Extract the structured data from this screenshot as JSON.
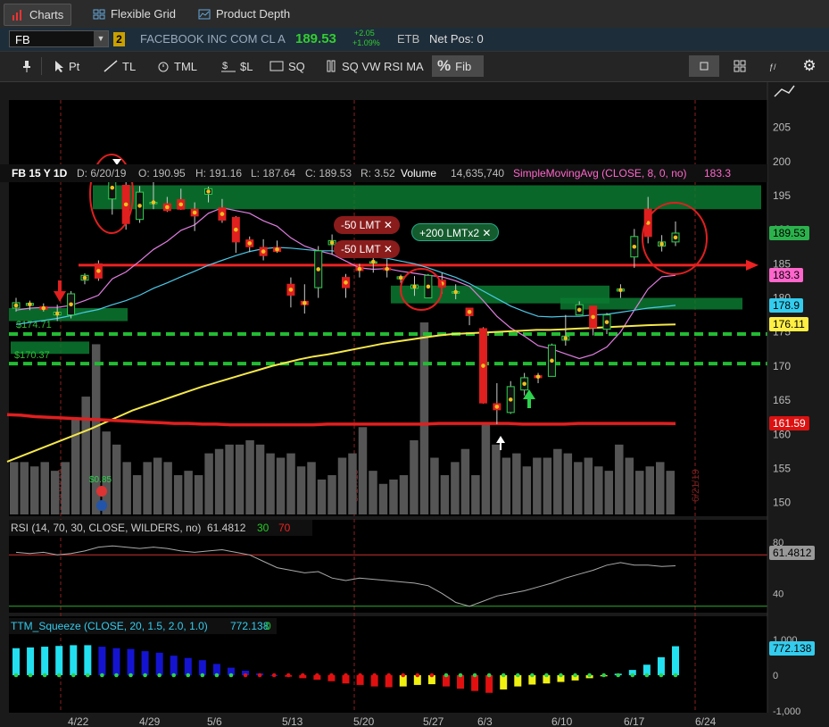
{
  "tabs": [
    {
      "label": "Charts",
      "icon": "bar-chart-icon"
    },
    {
      "label": "Flexible Grid",
      "icon": "grid-icon"
    },
    {
      "label": "Product Depth",
      "icon": "depth-icon"
    }
  ],
  "symbol": {
    "value": "FB",
    "link": "2",
    "name": "FACEBOOK INC COM CL A",
    "price": "189.53",
    "change": "+2.05",
    "change_pct": "+1.09%",
    "exchange": "ETB",
    "position": "Net Pos: 0"
  },
  "toolbar": {
    "items": [
      "Pt",
      "TL",
      "TML",
      "$L",
      "SQ",
      "SQ VW RSI MA",
      "Fib"
    ]
  },
  "info": {
    "title": "FB 15 Y 1D",
    "date": "D: 6/20/19",
    "open": "O: 190.95",
    "high": "H: 191.16",
    "low": "L: 187.64",
    "close": "C: 189.53",
    "range": "R: 3.52",
    "volume_label": "Volume",
    "volume": "14,635,740",
    "sma": "SimpleMovingAvg (CLOSE, 8, 0, no)",
    "sma_value": "183.3"
  },
  "price_axis": [
    "205",
    "200",
    "195",
    "190",
    "185",
    "180",
    "175",
    "170",
    "165",
    "160",
    "155",
    "150"
  ],
  "price_labels": [
    {
      "text": "189.53",
      "bg": "#2bb24c",
      "fg": "#000"
    },
    {
      "text": "183.3",
      "bg": "#ff66cc",
      "fg": "#000"
    },
    {
      "text": "178.9",
      "bg": "#33ccee",
      "fg": "#000"
    },
    {
      "text": "176.11",
      "bg": "#ffee44",
      "fg": "#000"
    },
    {
      "text": "161.59",
      "bg": "#dd1111",
      "fg": "#fff"
    }
  ],
  "zone_labels": [
    "$174.71",
    "$170.37"
  ],
  "orders": [
    "-50 LMT",
    "-50 LMT",
    "+200 LMTx2"
  ],
  "date_markers": [
    "4/19/19",
    "5/17/19",
    "6/21/19"
  ],
  "dividend": "$0.85",
  "rsi": {
    "title": "RSI (14, 70, 30, CLOSE, WILDERS, no)",
    "value": "61.4812",
    "ob": "30",
    "os": "70",
    "axis": [
      "80",
      "40"
    ],
    "label": "61.4812"
  },
  "ttm": {
    "title": "TTM_Squeeze (CLOSE, 20, 1.5, 2.0, 1.0)",
    "value": "772.138",
    "zero": "0",
    "axis": [
      "1,000",
      "0",
      "-1,000"
    ],
    "label": "772.138"
  },
  "x_axis": [
    "4/22",
    "4/29",
    "5/6",
    "5/13",
    "5/20",
    "5/27",
    "6/3",
    "6/10",
    "6/17",
    "6/24"
  ],
  "chart_data": {
    "type": "candlestick",
    "title": "FB 15 Y 1D",
    "ylim": [
      148,
      209
    ],
    "candles": [
      {
        "o": 178.5,
        "h": 180,
        "l": 178,
        "c": 179.3
      },
      {
        "o": 178.9,
        "h": 179.6,
        "l": 178.2,
        "c": 179.2
      },
      {
        "o": 178.7,
        "h": 179.2,
        "l": 178,
        "c": 178.3
      },
      {
        "o": 177.5,
        "h": 179,
        "l": 176.6,
        "c": 177.9
      },
      {
        "o": 177.5,
        "h": 181,
        "l": 177,
        "c": 180.6
      },
      {
        "o": 182.6,
        "h": 183.6,
        "l": 182,
        "c": 183.3
      },
      {
        "o": 185,
        "h": 185.5,
        "l": 182.5,
        "c": 182.9
      },
      {
        "o": 194.5,
        "h": 199.5,
        "l": 192.2,
        "c": 197.8
      },
      {
        "o": 196.5,
        "h": 197,
        "l": 190,
        "c": 190.9
      },
      {
        "o": 191.5,
        "h": 196.4,
        "l": 191,
        "c": 195.5
      },
      {
        "o": 194,
        "h": 197.8,
        "l": 193,
        "c": 194
      },
      {
        "o": 193.8,
        "h": 194.8,
        "l": 192.6,
        "c": 192.8
      },
      {
        "o": 194.4,
        "h": 196,
        "l": 192.9,
        "c": 193
      },
      {
        "o": 193,
        "h": 194,
        "l": 189.8,
        "c": 192
      },
      {
        "o": 195.2,
        "h": 196.3,
        "l": 194,
        "c": 196
      },
      {
        "o": 193.2,
        "h": 194.5,
        "l": 191,
        "c": 191.4
      },
      {
        "o": 191.8,
        "h": 192,
        "l": 186.6,
        "c": 188.2
      },
      {
        "o": 188.5,
        "h": 189,
        "l": 186.7,
        "c": 187.5
      },
      {
        "o": 187.4,
        "h": 188.6,
        "l": 185.5,
        "c": 186.2
      },
      {
        "o": 187.4,
        "h": 188.4,
        "l": 186.6,
        "c": 186.8
      },
      {
        "o": 182,
        "h": 183,
        "l": 178.6,
        "c": 180.4
      },
      {
        "o": 179.5,
        "h": 182,
        "l": 177.7,
        "c": 179
      },
      {
        "o": 181.5,
        "h": 187.6,
        "l": 180,
        "c": 186.9
      },
      {
        "o": 187.8,
        "h": 189.3,
        "l": 186.3,
        "c": 188.4
      },
      {
        "o": 183,
        "h": 183.5,
        "l": 180,
        "c": 181.5
      },
      {
        "o": 184.5,
        "h": 185,
        "l": 183,
        "c": 184
      },
      {
        "o": 185.3,
        "h": 186,
        "l": 183.7,
        "c": 185.3
      },
      {
        "o": 184.4,
        "h": 185.7,
        "l": 183,
        "c": 184.1
      },
      {
        "o": 182.8,
        "h": 183.4,
        "l": 182.2,
        "c": 183.1
      },
      {
        "o": 181.4,
        "h": 183.2,
        "l": 180.3,
        "c": 181.9
      },
      {
        "o": 180,
        "h": 183.5,
        "l": 180,
        "c": 183.3
      },
      {
        "o": 182.6,
        "h": 183.7,
        "l": 180.6,
        "c": 181.6
      },
      {
        "o": 180.8,
        "h": 182,
        "l": 179.8,
        "c": 180.9
      },
      {
        "o": 178.5,
        "h": 178.5,
        "l": 176,
        "c": 177.4
      },
      {
        "o": 175.5,
        "h": 175.7,
        "l": 164.5,
        "c": 164.6
      },
      {
        "o": 164.5,
        "h": 167.5,
        "l": 161.5,
        "c": 163.6
      },
      {
        "o": 163.2,
        "h": 167.8,
        "l": 163,
        "c": 167
      },
      {
        "o": 166.5,
        "h": 169,
        "l": 165.7,
        "c": 168.3
      },
      {
        "o": 168.6,
        "h": 169,
        "l": 167.5,
        "c": 168.3
      },
      {
        "o": 168.5,
        "h": 173.3,
        "l": 168.5,
        "c": 173.1
      },
      {
        "o": 173.8,
        "h": 177.5,
        "l": 173,
        "c": 174.4
      },
      {
        "o": 177.5,
        "h": 179.5,
        "l": 177.5,
        "c": 179
      },
      {
        "o": 178.8,
        "h": 178.8,
        "l": 174.5,
        "c": 175.6
      },
      {
        "o": 175.4,
        "h": 177.8,
        "l": 174.7,
        "c": 177.5
      },
      {
        "o": 181,
        "h": 182,
        "l": 180,
        "c": 181.3
      },
      {
        "o": 186,
        "h": 190.1,
        "l": 184.4,
        "c": 189
      },
      {
        "o": 193,
        "h": 194.8,
        "l": 188,
        "c": 189
      },
      {
        "o": 187.6,
        "h": 189.2,
        "l": 186.8,
        "c": 188.2
      },
      {
        "o": 188.2,
        "h": 191.2,
        "l": 187.6,
        "c": 189.5
      }
    ],
    "volume": [
      12,
      12,
      11,
      12,
      10,
      12,
      22,
      27,
      39,
      19,
      16,
      12,
      9,
      12,
      13,
      12,
      9,
      10,
      9,
      14,
      15,
      16,
      16,
      17,
      16,
      14,
      13,
      14,
      11,
      12,
      8,
      9,
      13,
      14,
      20,
      10,
      7,
      8,
      9,
      17,
      44,
      13,
      9,
      12,
      15,
      9,
      21,
      16,
      13,
      14,
      11,
      13,
      13,
      15,
      14,
      12,
      13,
      11,
      10,
      16,
      13,
      10,
      11,
      12,
      10
    ],
    "series": [
      {
        "name": "SMA 8",
        "values": [
          178.2,
          178.5,
          178.6,
          178.6,
          178.9,
          179.6,
          180.4,
          182.8,
          183.8,
          185.4,
          187.1,
          188.3,
          189.9,
          190.7,
          192.4,
          193.2,
          192.8,
          192.4,
          191.3,
          190.5,
          188.8,
          187.6,
          186.9,
          186.4,
          185.4,
          184.4,
          184.2,
          184.3,
          183.9,
          183.6,
          183.3,
          183.1,
          182.5,
          181.7,
          179.6,
          177.3,
          175.6,
          174.4,
          173,
          172.5,
          171.8,
          171.1,
          171.7,
          172.8,
          175,
          178.2,
          181.3,
          183.1,
          183.3
        ]
      },
      {
        "name": "SMA 20",
        "values": [
          176.1,
          176.4,
          176.7,
          177,
          177.4,
          177.9,
          178.3,
          179,
          179.6,
          180.4,
          181.4,
          182.2,
          183.1,
          183.9,
          184.8,
          185.5,
          186.2,
          186.8,
          187.2,
          187.4,
          187.3,
          187.1,
          186.9,
          186.9,
          186.6,
          186.3,
          186,
          185.8,
          185.4,
          185,
          184.4,
          183.7,
          183,
          182.1,
          181,
          179.9,
          178.8,
          178,
          177.3,
          177.2,
          177.3,
          177.3,
          177.5,
          177.6,
          177.9,
          178.2,
          178.5,
          178.7,
          178.9
        ]
      },
      {
        "name": "SMA 50",
        "values": [
          156,
          156.8,
          157.6,
          158.4,
          159.2,
          160,
          160.8,
          161.7,
          162.6,
          163.5,
          164.2,
          164.9,
          165.6,
          166.3,
          167,
          167.6,
          168.2,
          168.8,
          169.4,
          170,
          170.5,
          171,
          171.4,
          171.7,
          172.1,
          172.5,
          172.9,
          173.3,
          173.6,
          173.9,
          174.2,
          174.5,
          174.7,
          174.8,
          174.9,
          175,
          175.1,
          175.2,
          175.3,
          175.3,
          175.4,
          175.5,
          175.6,
          175.7,
          175.8,
          175.9,
          176,
          176.06,
          176.11
        ]
      },
      {
        "name": "SMA 200",
        "values": [
          162.9,
          162.8,
          162.6,
          162.5,
          162.4,
          162.3,
          162.2,
          162.1,
          162,
          161.9,
          161.8,
          161.7,
          161.6,
          161.6,
          161.5,
          161.5,
          161.4,
          161.4,
          161.4,
          161.4,
          161.4,
          161.4,
          161.4,
          161.5,
          161.5,
          161.5,
          161.5,
          161.5,
          161.5,
          161.5,
          161.5,
          161.6,
          161.6,
          161.6,
          161.6,
          161.6,
          161.6,
          161.5,
          161.5,
          161.5,
          161.5,
          161.6,
          161.6,
          161.6,
          161.6,
          161.6,
          161.6,
          161.6,
          161.59
        ]
      }
    ],
    "zones": [
      {
        "from": 193,
        "to": 196.5
      },
      {
        "from": 179.2,
        "to": 181.8
      },
      {
        "from": 178.3,
        "to": 180
      },
      {
        "from": 176.6,
        "to": 178.5
      },
      {
        "from": 171.8,
        "to": 173.6
      }
    ],
    "levels": [
      {
        "value": 184.8,
        "color": "#ee2222"
      },
      {
        "value": 174.71,
        "color": "#22bb33"
      },
      {
        "value": 170.37,
        "color": "#22bb33"
      }
    ],
    "rsi_values": [
      72,
      71,
      72,
      70,
      71,
      73,
      76,
      77,
      76,
      75,
      76,
      75,
      73,
      72,
      73,
      74,
      72,
      70,
      65,
      60,
      58,
      56,
      57,
      52,
      50,
      52,
      51,
      50,
      49,
      48,
      46,
      40,
      33,
      30,
      34,
      38,
      40,
      42,
      45,
      48,
      52,
      55,
      58,
      62,
      64,
      62,
      62,
      61,
      61.48
    ],
    "rsi_ylim": [
      25,
      82
    ],
    "ttm_values": [
      720,
      740,
      760,
      780,
      800,
      800,
      760,
      720,
      700,
      640,
      600,
      520,
      460,
      400,
      300,
      200,
      120,
      50,
      0,
      -40,
      -80,
      -120,
      -160,
      -220,
      -260,
      -300,
      -320,
      -300,
      -260,
      -240,
      -300,
      -360,
      -420,
      -470,
      -380,
      -300,
      -250,
      -220,
      -180,
      -140,
      -80,
      -30,
      40,
      140,
      280,
      480,
      772.138
    ],
    "ttm_ylim": [
      -1000,
      1000
    ]
  }
}
